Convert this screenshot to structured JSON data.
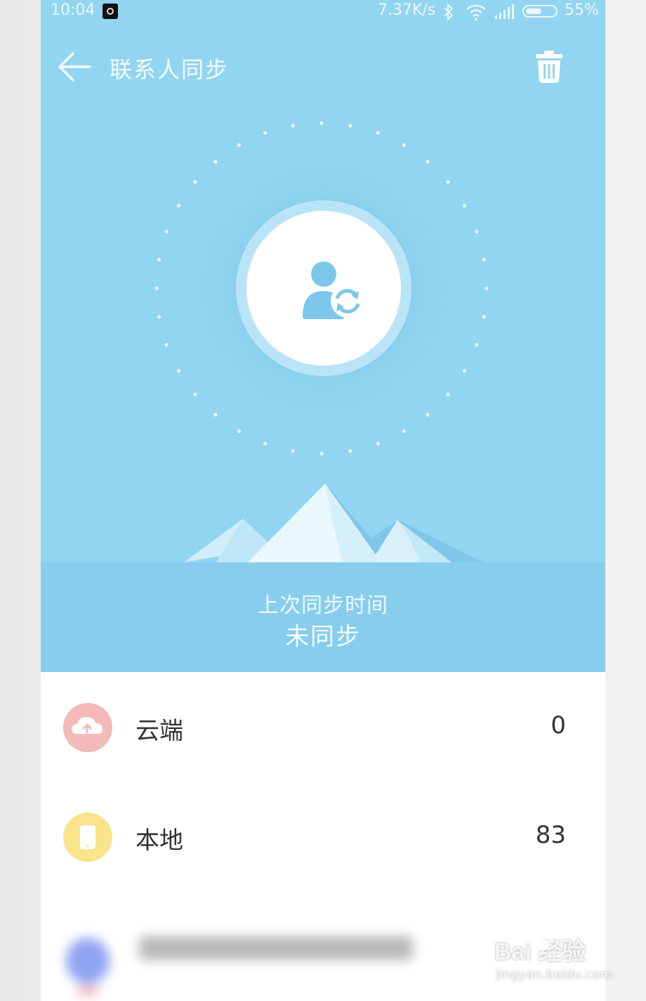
{
  "status_bar": {
    "time": "10:04",
    "network_speed": "7.37K/s",
    "battery": "55%",
    "battery_level": 0.55,
    "icons": [
      "notification-app-icon",
      "bluetooth-icon",
      "wifi-icon",
      "signal-icon",
      "battery-icon"
    ]
  },
  "app_bar": {
    "title": "联系人同步",
    "back_icon": "arrow-left-icon",
    "action_icon": "trash-icon"
  },
  "hero": {
    "center_icon": "contact-sync-icon",
    "last_sync_label": "上次同步时间",
    "last_sync_value": "未同步"
  },
  "list": [
    {
      "label": "云端",
      "count": "0",
      "icon": "cloud-upload-icon",
      "icon_color": "#f4b9b9"
    },
    {
      "label": "本地",
      "count": "83",
      "icon": "phone-icon",
      "icon_color": "#f8e48a"
    }
  ],
  "watermark": {
    "brand": "Bai 经验",
    "url": "jingyan.baidu.com"
  },
  "colors": {
    "hero_bg": "#92d5f0",
    "band_bg": "#88cdee",
    "accent": "#7cc7ea"
  }
}
